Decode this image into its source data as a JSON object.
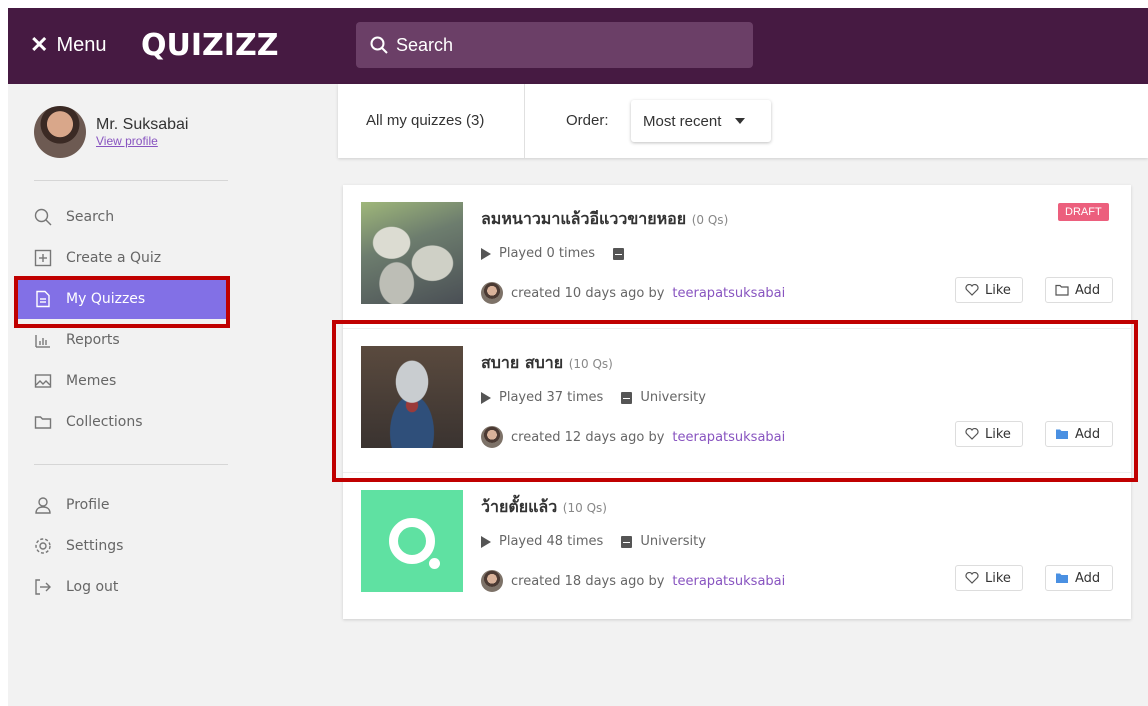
{
  "header": {
    "menu_label": "Menu",
    "logo_text": "QUIZIZZ",
    "search_placeholder": "Search"
  },
  "sidebar": {
    "profile": {
      "name": "Mr. Suksabai",
      "link": "View profile"
    },
    "items": [
      {
        "label": "Search",
        "icon": "search-icon"
      },
      {
        "label": "Create a Quiz",
        "icon": "plus-square-icon"
      },
      {
        "label": "My Quizzes",
        "icon": "document-icon",
        "active": true
      },
      {
        "label": "Reports",
        "icon": "bar-chart-icon"
      },
      {
        "label": "Memes",
        "icon": "image-icon"
      },
      {
        "label": "Collections",
        "icon": "folder-icon"
      }
    ],
    "bottom_items": [
      {
        "label": "Profile",
        "icon": "user-icon"
      },
      {
        "label": "Settings",
        "icon": "gear-icon"
      },
      {
        "label": "Log out",
        "icon": "logout-icon"
      }
    ]
  },
  "filters": {
    "all_label": "All my quizzes (3)",
    "order_label": "Order:",
    "order_value": "Most recent"
  },
  "quizzes": [
    {
      "title": "ลมหนาวมาแล้วอีแววขายหอย",
      "questions": "(0 Qs)",
      "played": "Played 0 times",
      "subject": "",
      "created": "created 10 days ago by",
      "author": "teerapatsuksabai",
      "badge": "DRAFT",
      "like_label": "Like",
      "add_label": "Add"
    },
    {
      "title": "สบาย สบาย",
      "questions": "(10 Qs)",
      "played": "Played 37 times",
      "subject": "University",
      "created": "created 12 days ago by",
      "author": "teerapatsuksabai",
      "like_label": "Like",
      "add_label": "Add"
    },
    {
      "title": "ว้ายตั้ยแล้ว",
      "questions": "(10 Qs)",
      "played": "Played 48 times",
      "subject": "University",
      "created": "created 18 days ago by",
      "author": "teerapatsuksabai",
      "like_label": "Like",
      "add_label": "Add"
    }
  ],
  "colors": {
    "header_bg": "#461a42",
    "accent": "#8270e6",
    "link": "#8854c0",
    "draft_badge": "#ec5f7d",
    "highlight": "#c00000",
    "folder_filled": "#4a90e2"
  }
}
